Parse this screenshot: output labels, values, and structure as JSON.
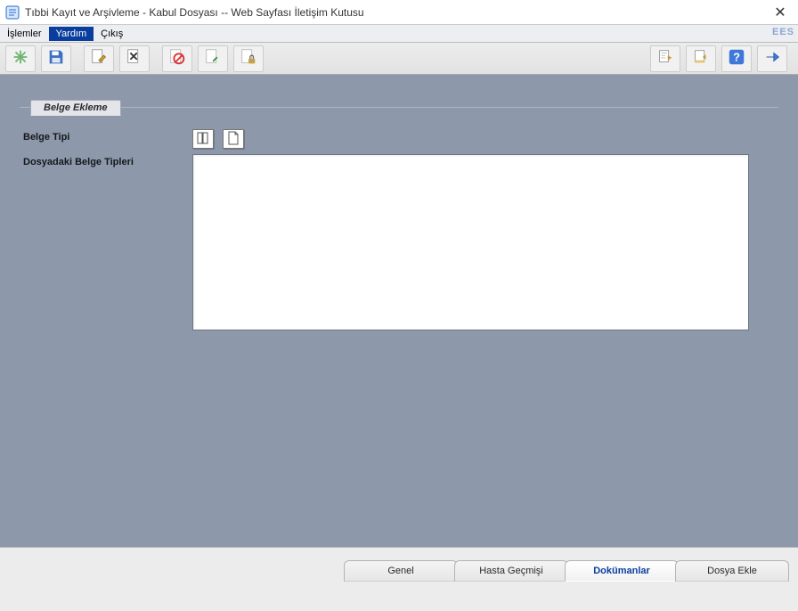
{
  "window": {
    "title": "Tıbbi Kayıt ve Arşivleme - Kabul Dosyası -- Web Sayfası İletişim Kutusu"
  },
  "menu": {
    "items": [
      "İşlemler",
      "Yardım",
      "Çıkış"
    ],
    "active_index": 1,
    "brand": "EES"
  },
  "toolbar": {
    "left": [
      {
        "name": "new-record-icon"
      },
      {
        "name": "save-icon"
      },
      {
        "name": "edit-icon"
      },
      {
        "name": "delete-icon"
      },
      {
        "name": "block-icon"
      },
      {
        "name": "document-edit-icon"
      },
      {
        "name": "document-lock-icon"
      }
    ],
    "right": [
      {
        "name": "import-icon"
      },
      {
        "name": "export-icon"
      },
      {
        "name": "help-icon"
      },
      {
        "name": "forward-icon"
      }
    ]
  },
  "group": {
    "title": "Belge Ekleme",
    "labels": {
      "belge_tipi": "Belge Tipi",
      "dosyadaki_belge_tipleri": "Dosyadaki Belge Tipleri"
    }
  },
  "bottom_tabs": {
    "items": [
      "Genel",
      "Hasta Geçmişi",
      "Dokümanlar",
      "Dosya Ekle"
    ],
    "active_index": 2
  }
}
